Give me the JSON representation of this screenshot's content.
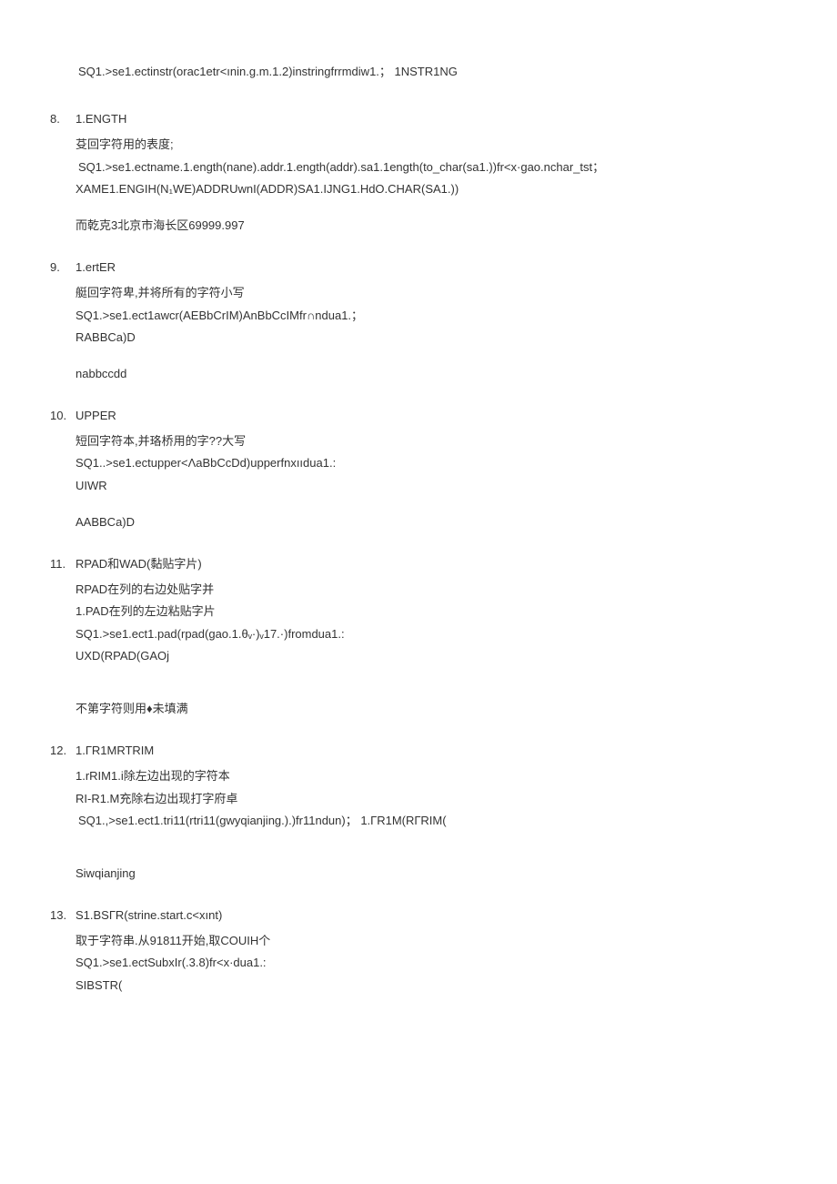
{
  "pre": {
    "line1": "SQ1.>se1.ectinstr(orac1etr<ınin.g.m.1.2)instringfrrmdiw1.；  1NSTR1NG"
  },
  "items": [
    {
      "num": "8.",
      "heading": "1.ENGTH",
      "lines": [
        {
          "text": "芟回字符用的表度;",
          "cls": "line"
        },
        {
          "text": "SQ1.>se1.ectname.1.ength(nane).addr.1.ength(addr).sa1.1ength(to_char(sa1.))fr<x·gao.nchar_tst；",
          "cls": "line indent"
        },
        {
          "text": "XAME1.ENGIH(N₁WE)ADDRUwnI(ADDR)SA1.IJNG1.HdO.CHAR(SA1.))",
          "cls": "line"
        },
        {
          "text": "而乾克3北京市海长区69999.997",
          "cls": "line gap"
        }
      ]
    },
    {
      "num": "9.",
      "heading": "1.ertER",
      "lines": [
        {
          "text": "艇回字符卑,并将所有的字符小写",
          "cls": "line"
        },
        {
          "text": "SQ1.>se1.ect1awcr(AEBbCrIM)AnBbCcIMfr∩ndua1.；",
          "cls": "line"
        },
        {
          "text": "RABBCa)D",
          "cls": "line"
        },
        {
          "text": "nabbccdd",
          "cls": "line gap"
        }
      ]
    },
    {
      "num": "10.",
      "heading": "UPPER",
      "lines": [
        {
          "text": "短回字符本,并珞桥用的字??大写",
          "cls": "line"
        },
        {
          "text": "SQ1..>se1.ectupper<ΛaBbCcDd)upperfnxııdua1.:",
          "cls": "line"
        },
        {
          "text": "UIWR",
          "cls": "line"
        },
        {
          "text": "AABBCa)D",
          "cls": "line gap"
        }
      ]
    },
    {
      "num": "11.",
      "heading": "RPAD和WAD(黏贴字片)",
      "lines": [
        {
          "text": "RPAD在列的右边处贴字并",
          "cls": "line"
        },
        {
          "text": "1.PAD在列的左边粘贴字片",
          "cls": "line"
        },
        {
          "text": "SQ1.>se1.ect1.pad(rpad(gao.1.θᵥ·)ᵥ17.·)fromdua1.:",
          "cls": "line"
        },
        {
          "text": "UXD(RPAD(GAOj",
          "cls": "line"
        },
        {
          "text": "不第字符则用♦未填满",
          "cls": "line gap",
          "extraGap": true
        }
      ]
    },
    {
      "num": "12.",
      "heading": "1.ГR1MRTRIM",
      "lines": [
        {
          "text": "1.rRIM1.i除左边出现的字符本",
          "cls": "line"
        },
        {
          "text": "RI-R1.M充除右边出现打字府卓",
          "cls": "line"
        },
        {
          "text": "SQ1.,>se1.ect1.tri11(rtri11(gwyqianjing.).)fr11ndun)；  1.ГR1M(RГRIM(",
          "cls": "line indent"
        },
        {
          "text": "Siwqianjing",
          "cls": "line gap",
          "extraGap": true
        }
      ]
    },
    {
      "num": "13.",
      "heading": "S1.BSГR(strine.start.c<xınt)",
      "lines": [
        {
          "text": "取于字符串.从91811开始,取COUIH个",
          "cls": "line"
        },
        {
          "text": "SQ1.>se1.ectSubxIr(.3.8)fr<x·dua1.:",
          "cls": "line"
        },
        {
          "text": "SIBSTR(",
          "cls": "line"
        }
      ]
    }
  ]
}
